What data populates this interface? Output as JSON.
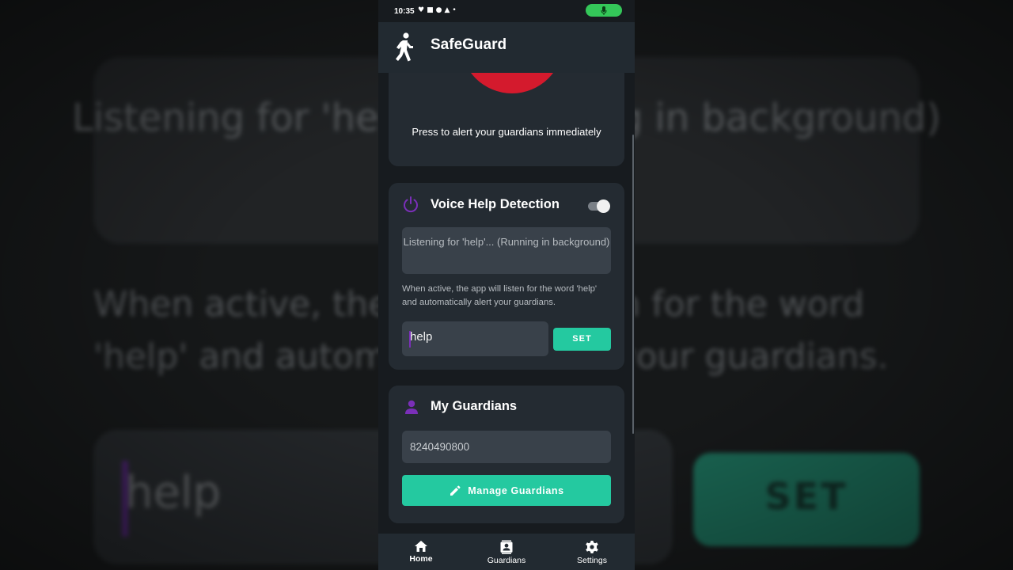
{
  "status_bar": {
    "time": "10:35",
    "icons": [
      "heart-icon",
      "video-icon",
      "whatsapp-icon",
      "android-icon",
      "dot"
    ]
  },
  "app": {
    "title": "SafeGuard"
  },
  "sos": {
    "caption": "Press to alert your guardians immediately",
    "button_color": "#d41a2d"
  },
  "voice": {
    "title": "Voice Help Detection",
    "enabled": true,
    "status_text": "Listening for 'help'... (Running in background)",
    "description": "When active, the app will listen for the word 'help' and automatically alert your guardians.",
    "keyword_value": "help",
    "set_label": "SET"
  },
  "guardians": {
    "title": "My Guardians",
    "phone": "8240490800",
    "manage_label": "Manage Guardians"
  },
  "nav": {
    "items": [
      {
        "label": "Home",
        "icon": "home-icon",
        "active": true
      },
      {
        "label": "Guardians",
        "icon": "contacts-icon",
        "active": false
      },
      {
        "label": "Settings",
        "icon": "gear-icon",
        "active": false
      }
    ]
  },
  "colors": {
    "accent": "#24c9a0",
    "purple": "#7a2fb8",
    "card": "#242b32",
    "background": "#171b1f"
  }
}
